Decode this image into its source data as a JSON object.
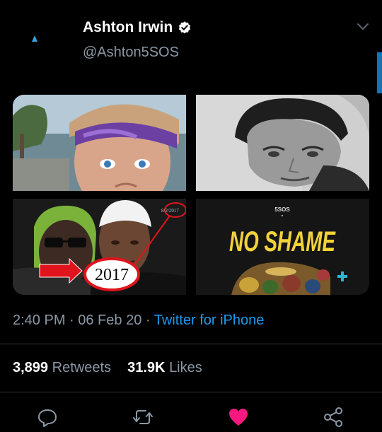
{
  "tweet": {
    "author_name": "Ashton Irwin",
    "author_handle": "@Ashton5SOS",
    "timestamp": "2:40 PM · 06 Feb 20 · ",
    "source": "Twitter for iPhone",
    "retweets_count": "3,899",
    "retweets_label": "Retweets",
    "likes_count": "31.9K",
    "likes_label": "Likes"
  },
  "media": {
    "image3_overlay_small": "8/2/2017",
    "image3_overlay_big": "2017",
    "image4_brand": "5SOS",
    "image4_title": "NO SHAME"
  },
  "icons": {
    "verified": "verified-badge-icon",
    "more": "chevron-down-icon",
    "reply": "reply-icon",
    "retweet": "retweet-icon",
    "like": "heart-icon",
    "share": "share-icon"
  },
  "colors": {
    "background": "#000000",
    "accent": "#1d9bf0",
    "like": "#f91880",
    "secondary_text": "#8b98a5"
  }
}
